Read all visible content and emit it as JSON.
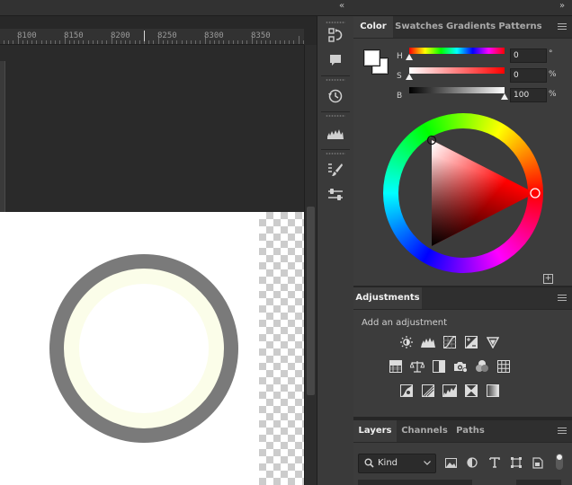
{
  "topbar": {
    "collapse_left": "«",
    "collapse_right": "»"
  },
  "ruler": {
    "labels": [
      "8100",
      "8150",
      "8200",
      "8250",
      "8300",
      "8350"
    ]
  },
  "artwork": {
    "outer_ring_color": "#7a7a7a",
    "inner_ring_color": "#fbfde9",
    "center_color": "#ffffff"
  },
  "iconstrip": {
    "icons": [
      "history-brush-swap-icon",
      "comment-icon",
      "history-icon",
      "histogram-icon",
      "brush-settings-icon",
      "properties-icon"
    ]
  },
  "color_panel": {
    "tabs": [
      {
        "label": "Color",
        "active": true
      },
      {
        "label": "Swatches",
        "active": false
      },
      {
        "label": "Gradients",
        "active": false
      },
      {
        "label": "Patterns",
        "active": false
      }
    ],
    "foreground_color": "#ffffff",
    "background_color": "#ffffff",
    "hsb": [
      {
        "label": "H",
        "value": "0",
        "unit": "°",
        "level": 0
      },
      {
        "label": "S",
        "value": "0",
        "unit": "%",
        "level": 0
      },
      {
        "label": "B",
        "value": "100",
        "unit": "%",
        "level": 1
      }
    ],
    "hue_color": "#ff0000",
    "add_swatch": "+"
  },
  "adjustments_panel": {
    "tab": "Adjustments",
    "subtitle": "Add an adjustment",
    "rows": [
      [
        "brightness-contrast-icon",
        "levels-icon",
        "curves-icon",
        "exposure-icon",
        "vibrance-icon"
      ],
      [
        "hue-saturation-icon",
        "color-balance-icon",
        "black-white-icon",
        "photo-filter-icon",
        "channel-mixer-icon",
        "color-lookup-icon"
      ],
      [
        "invert-icon",
        "posterize-icon",
        "threshold-icon",
        "selective-color-icon",
        "gradient-map-icon"
      ]
    ]
  },
  "layers_panel": {
    "tabs": [
      {
        "label": "Layers",
        "active": true
      },
      {
        "label": "Channels",
        "active": false
      },
      {
        "label": "Paths",
        "active": false
      }
    ],
    "filter_kind": "Kind",
    "filter_icons": [
      "pixel-filter-icon",
      "adjustment-filter-icon",
      "type-filter-icon",
      "shape-filter-icon",
      "smart-object-filter-icon"
    ]
  }
}
